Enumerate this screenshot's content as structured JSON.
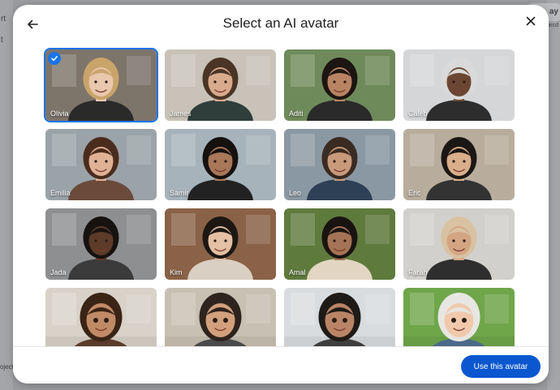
{
  "background": {
    "fragments": [
      "rt",
      "t",
      "ay",
      "arcd",
      "oject"
    ]
  },
  "dialog": {
    "title": "Select an AI avatar",
    "primary_button": "Use this avatar",
    "accent_color": "#0b57d0"
  },
  "avatars": [
    {
      "name": "Olivia",
      "selected": true,
      "style": "photo",
      "bg": "#7d746a",
      "skin": "#e9c7ad",
      "hair": "#c9a46a",
      "shirt": "#2a2a2a"
    },
    {
      "name": "James",
      "selected": false,
      "style": "photo",
      "bg": "#c8c2b8",
      "skin": "#d8ab8d",
      "hair": "#4a3425",
      "shirt": "#2f3e3a"
    },
    {
      "name": "Aditi",
      "selected": false,
      "style": "photo",
      "bg": "#6f8a5a",
      "skin": "#b98462",
      "hair": "#1d1512",
      "shirt": "#2a2a2a"
    },
    {
      "name": "Caleb",
      "selected": false,
      "style": "photo",
      "bg": "#d4d6d8",
      "skin": "#6b4733",
      "hair": "#d9d9d9",
      "shirt": "#2d2d2d"
    },
    {
      "name": "Emilia",
      "selected": false,
      "style": "photo",
      "bg": "#9aa3a8",
      "skin": "#dfb296",
      "hair": "#4a2c1d",
      "shirt": "#6b4a3a"
    },
    {
      "name": "Samir",
      "selected": false,
      "style": "photo",
      "bg": "#a7b3bb",
      "skin": "#a87859",
      "hair": "#15110f",
      "shirt": "#222222"
    },
    {
      "name": "Leo",
      "selected": false,
      "style": "photo",
      "bg": "#8a98a3",
      "skin": "#c99a7a",
      "hair": "#3a2b22",
      "shirt": "#2e4056"
    },
    {
      "name": "Eric",
      "selected": false,
      "style": "photo",
      "bg": "#b8ad9d",
      "skin": "#d9ae8a",
      "hair": "#1b1714",
      "shirt": "#333333"
    },
    {
      "name": "Jada",
      "selected": false,
      "style": "photo",
      "bg": "#8d8f90",
      "skin": "#5c3b29",
      "hair": "#161210",
      "shirt": "#3b3b3b"
    },
    {
      "name": "Kim",
      "selected": false,
      "style": "photo",
      "bg": "#8a6247",
      "skin": "#e4c0a4",
      "hair": "#1c1713",
      "shirt": "#d9cfc2"
    },
    {
      "name": "Amal",
      "selected": false,
      "style": "photo",
      "bg": "#5f7a3d",
      "skin": "#a57456",
      "hair": "#1a1411",
      "shirt": "#e2d6c3"
    },
    {
      "name": "Farah",
      "selected": false,
      "style": "photo",
      "bg": "#d2d0cc",
      "skin": "#d4a583",
      "hair": "#d8c2a2",
      "shirt": "#2e2e2e"
    },
    {
      "name": "",
      "selected": false,
      "style": "cartoon",
      "bg": "#d8d2c8",
      "skin": "#c08a66",
      "hair": "#3a2416",
      "shirt": "#5b3a2a"
    },
    {
      "name": "",
      "selected": false,
      "style": "cartoon",
      "bg": "#c8c1b3",
      "skin": "#d2a07c",
      "hair": "#2f241d",
      "shirt": "#4a4a4a"
    },
    {
      "name": "",
      "selected": false,
      "style": "cartoon",
      "bg": "#d9dcdf",
      "skin": "#b98466",
      "hair": "#1e1a17",
      "shirt": "#3e3e3e"
    },
    {
      "name": "",
      "selected": false,
      "style": "cartoon",
      "bg": "#6fa64a",
      "skin": "#f0c9ac",
      "hair": "#e8e6e3",
      "shirt": "#4b6a8a"
    }
  ]
}
